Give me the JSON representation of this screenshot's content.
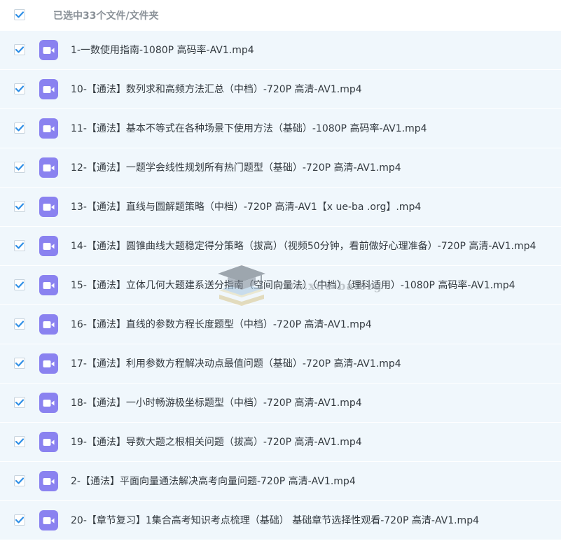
{
  "header": {
    "title": "已选中33个文件/文件夹"
  },
  "colors": {
    "accent": "#2f8fe6",
    "video_icon": "#8a82f0",
    "row_background": "#f0f7fc"
  },
  "icons": {
    "checkbox": "checkmark-icon",
    "file": "video-file-icon"
  },
  "files": [
    {
      "name": "1-一数使用指南-1080P 高码率-AV1.mp4",
      "checked": true
    },
    {
      "name": "10-【通法】数列求和高频方法汇总（中档）-720P 高清-AV1.mp4",
      "checked": true
    },
    {
      "name": "11-【通法】基本不等式在各种场景下使用方法（基础）-1080P 高码率-AV1.mp4",
      "checked": true
    },
    {
      "name": "12-【通法】一题学会线性规划所有热门题型（基础）-720P 高清-AV1.mp4",
      "checked": true
    },
    {
      "name": "13-【通法】直线与圆解题策略（中档）-720P 高清-AV1【x ue-ba .org】.mp4",
      "checked": true
    },
    {
      "name": "14-【通法】圆锥曲线大题稳定得分策略（拔高）（视频50分钟，看前做好心理准备）-720P 高清-AV1.mp4",
      "checked": true
    },
    {
      "name": "15-【通法】立体几何大题建系送分指南（空间向量法）（中档）（理科适用）-1080P 高码率-AV1.mp4",
      "checked": true
    },
    {
      "name": "16-【通法】直线的参数方程长度题型（中档）-720P 高清-AV1.mp4",
      "checked": true
    },
    {
      "name": "17-【通法】利用参数方程解决动点最值问题（基础）-720P 高清-AV1.mp4",
      "checked": true
    },
    {
      "name": "18-【通法】一小时畅游极坐标题型（中档）-720P 高清-AV1.mp4",
      "checked": true
    },
    {
      "name": "19-【通法】导数大题之根相关问题（拔高）-720P 高清-AV1.mp4",
      "checked": true
    },
    {
      "name": "2-【通法】平面向量通法解决高考向量问题-720P 高清-AV1.mp4",
      "checked": true
    },
    {
      "name": "20-【章节复习】1集合高考知识考点梳理（基础） 基础章节选择性观看-720P 高清-AV1.mp4",
      "checked": true
    }
  ],
  "watermark": {
    "text": "www.xue-ba.org"
  }
}
